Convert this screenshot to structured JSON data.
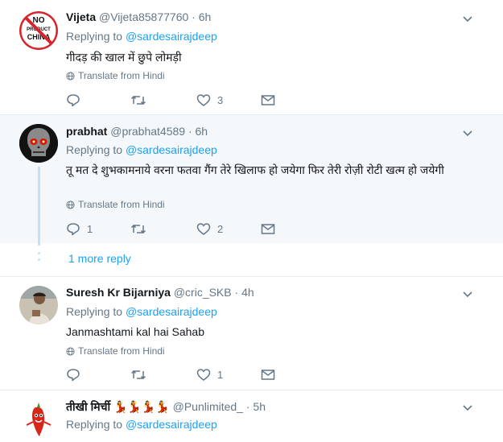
{
  "tweets": [
    {
      "name": "Vijeta",
      "handle": "@Vijeta85877760",
      "time": "· 6h",
      "replying_prefix": "Replying to",
      "replying_to": "@sardesairajdeep",
      "text": "गीदड़ की खाल में छुपे लोमड़ी",
      "translate": "Translate from Hindi",
      "replies": "",
      "retweets": "",
      "likes": "3",
      "avatar": "no-product-china-logo"
    },
    {
      "name": "prabhat",
      "handle": "@prabhat4589",
      "time": "· 6h",
      "replying_prefix": "Replying to",
      "replying_to": "@sardesairajdeep",
      "text": "तू मत दे शुभकामनाये वरना फतवा गैंग तेरे खिलाफ हो जयेगा फिर तेरी रोज़ी रोटी खत्म हो जयेगी",
      "translate": "Translate from Hindi",
      "replies": "1",
      "retweets": "",
      "likes": "2",
      "avatar": "red-eyed-skull"
    },
    {
      "name": "Suresh Kr Bijarniya",
      "handle": "@cric_SKB",
      "time": "· 4h",
      "replying_prefix": "Replying to",
      "replying_to": "@sardesairajdeep",
      "text": "Janmashtami kal hai Sahab",
      "translate": "Translate from Hindi",
      "replies": "",
      "retweets": "",
      "likes": "1",
      "avatar": "person-photo"
    },
    {
      "name": "तीखी मिर्ची",
      "name_emoji": "💃💃💃💃",
      "handle": "@Punlimited_",
      "time": "· 5h",
      "replying_prefix": "Replying to",
      "replying_to": "@sardesairajdeep",
      "avatar": "chili-pepper-cartoon"
    }
  ],
  "more_replies": "1 more reply",
  "logo_text": "NO PRODUCT CHINA",
  "colors": {
    "link": "#1da1f2",
    "muted": "#657786",
    "thread": "#bfe3fb",
    "highlight_bg": "#f5f8fa"
  }
}
